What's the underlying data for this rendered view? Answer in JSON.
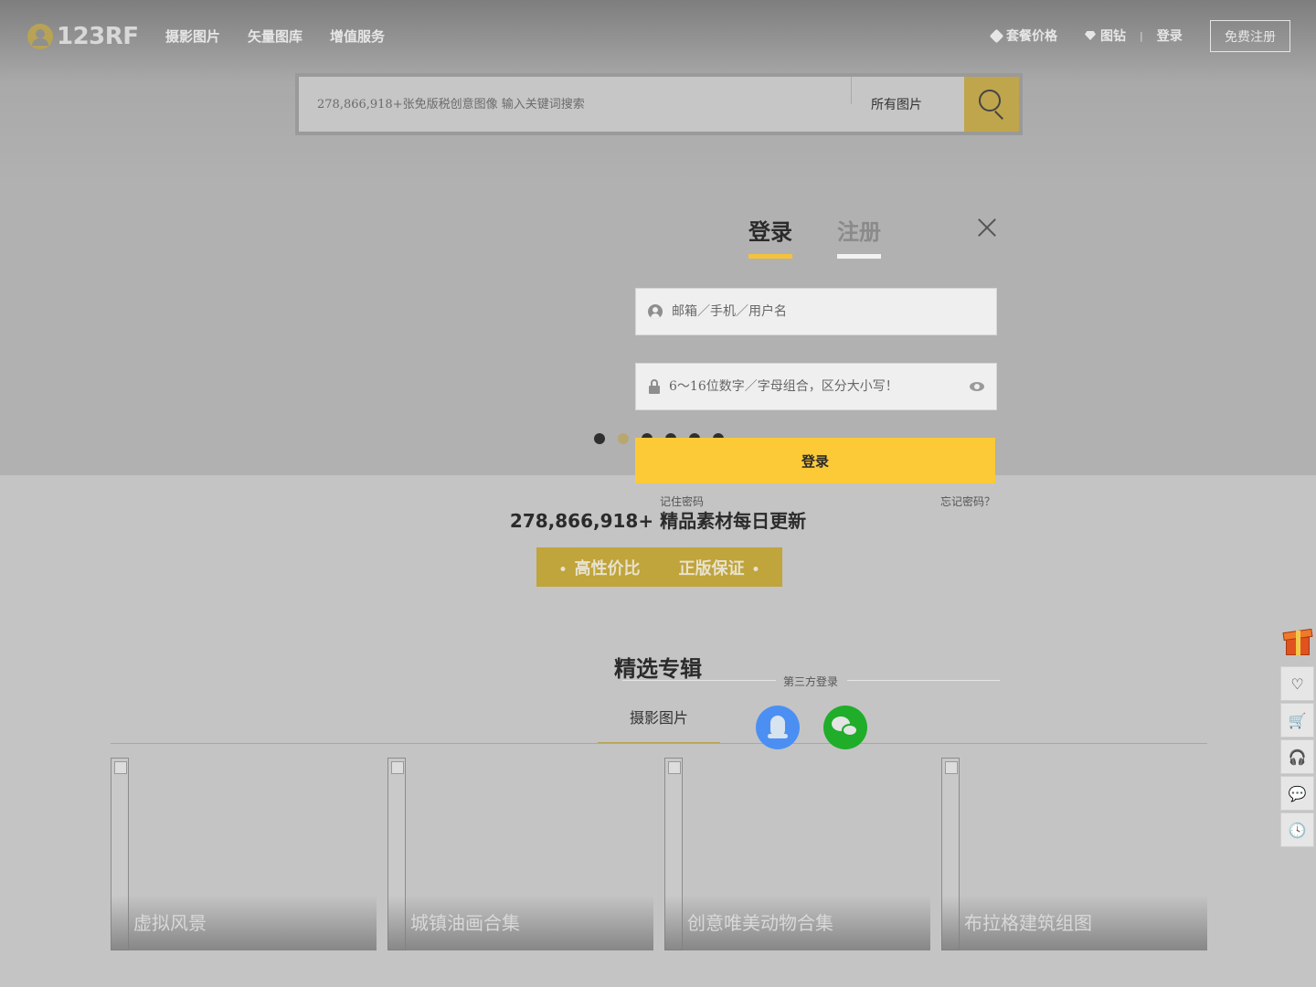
{
  "header": {
    "logo_text": "123RF",
    "nav": [
      "摄影图片",
      "矢量图库",
      "增值服务"
    ],
    "pricing": "套餐价格",
    "diamond": "图钻",
    "separator": "|",
    "login": "登录",
    "register": "免费注册"
  },
  "search": {
    "placeholder": "278,866,918+张免版税创意图像 输入关键词搜索",
    "filter": "所有图片"
  },
  "carousel": {
    "dot_count": 6,
    "active_index": 1
  },
  "main": {
    "stats": "278,866,918+ 精品素材每日更新",
    "badge_1": "高性价比",
    "badge_2": "正版保证",
    "section_title": "精选专辑",
    "category_tab": "摄影图片",
    "albums": [
      {
        "name": "虚拟风景"
      },
      {
        "name": "城镇油画合集"
      },
      {
        "name": "创意唯美动物合集"
      },
      {
        "name": "布拉格建筑组图"
      }
    ]
  },
  "login_modal": {
    "tab_login": "登录",
    "tab_register": "注册",
    "username_placeholder": "邮箱／手机／用户名",
    "password_placeholder": "6～16位数字／字母组合，区分大小写！",
    "submit": "登录",
    "remember": "记住密码",
    "forgot": "忘记密码？",
    "third_party": "第三方登录"
  },
  "float_bar": {
    "items": [
      "heart-icon",
      "cart-icon",
      "headset-icon",
      "chat-icon",
      "clock-icon"
    ],
    "glyphs": [
      "♡",
      "🛒",
      "🎧",
      "💬",
      "🕓"
    ]
  },
  "colors": {
    "accent_yellow": "#fdca37",
    "gold": "#c0a43c",
    "qq_blue": "#4b8ff2",
    "wechat_green": "#1fad2a"
  }
}
